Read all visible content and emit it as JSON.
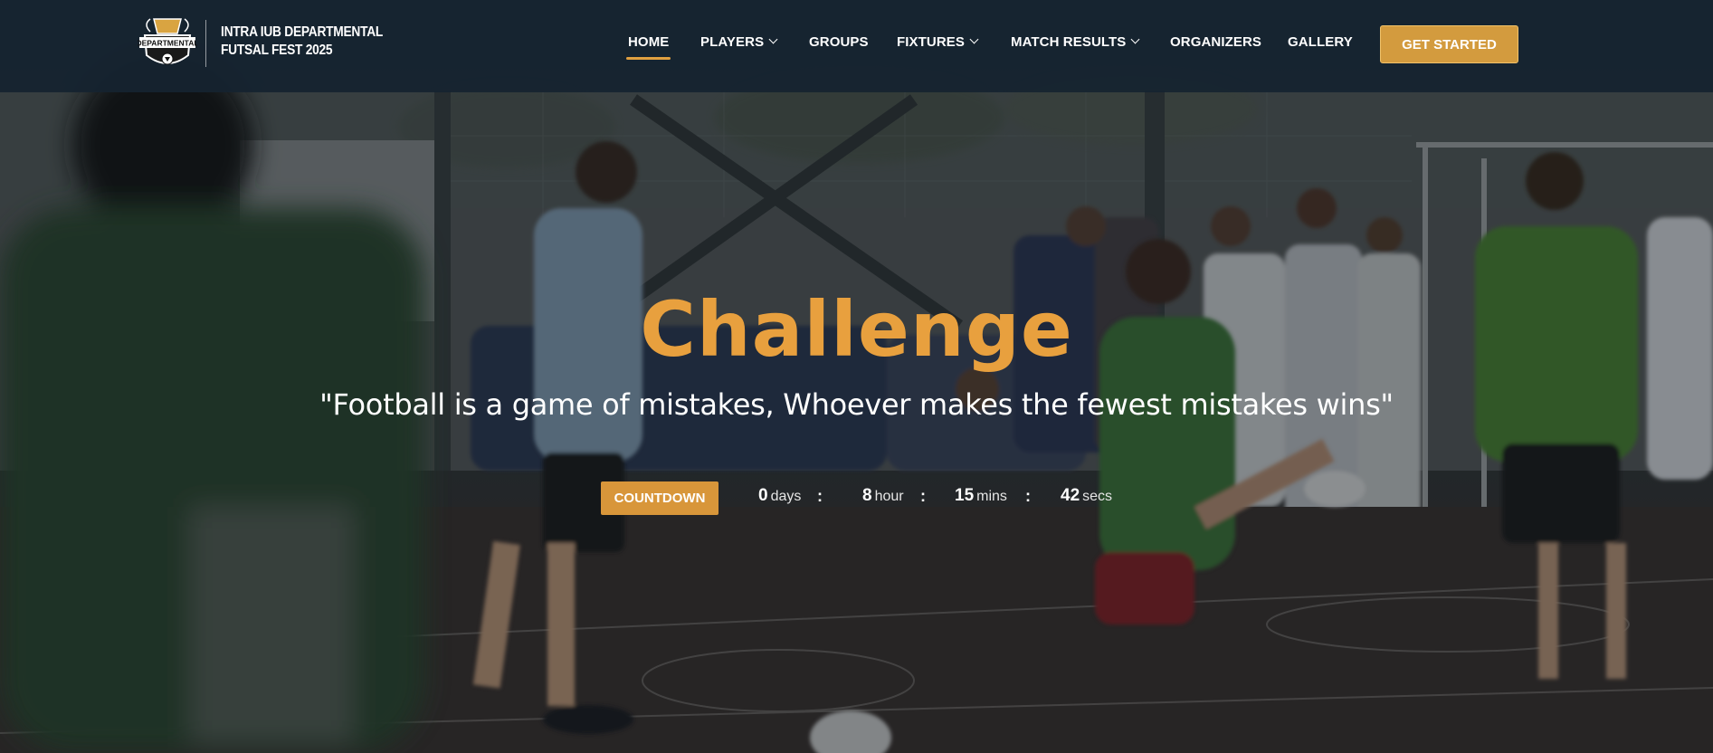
{
  "brand": {
    "logo_word": "DEPARTMENTAL",
    "title_line1": "INTRA IUB DEPARTMENTAL",
    "title_line2": "FUTSAL FEST 2025"
  },
  "nav": {
    "items": [
      {
        "label": "HOME",
        "active": true,
        "dropdown": false
      },
      {
        "label": "PLAYERS",
        "active": false,
        "dropdown": true
      },
      {
        "label": "GROUPS",
        "active": false,
        "dropdown": false
      },
      {
        "label": "FIXTURES",
        "active": false,
        "dropdown": true
      },
      {
        "label": "MATCH RESULTS",
        "active": false,
        "dropdown": true
      },
      {
        "label": "ORGANIZERS",
        "active": false,
        "dropdown": false
      },
      {
        "label": "GALLERY",
        "active": false,
        "dropdown": false
      }
    ],
    "cta_label": "GET STARTED"
  },
  "hero": {
    "title": "Challenge",
    "quote": "\"Football is a game of mistakes, Whoever makes the fewest mistakes wins\"",
    "countdown_label": "COUNTDOWN",
    "countdown": {
      "days": {
        "value": "0",
        "unit": "days"
      },
      "hours": {
        "value": "8",
        "unit": "hour"
      },
      "mins": {
        "value": "15",
        "unit": "mins"
      },
      "secs": {
        "value": "42",
        "unit": "secs"
      }
    },
    "separator": ":"
  },
  "colors": {
    "accent": "#e8a03e",
    "cta": "#d39b3e",
    "navbar": "#152430"
  }
}
